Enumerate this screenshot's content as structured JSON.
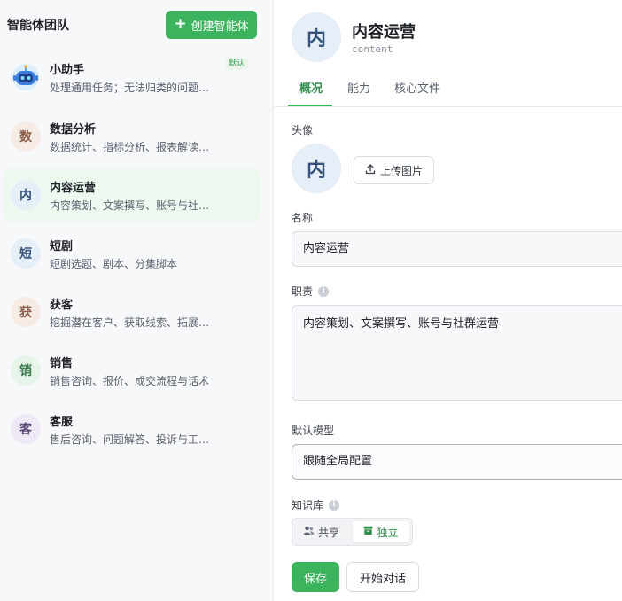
{
  "sidebar": {
    "title": "智能体团队",
    "create_label": "创建智能体",
    "default_badge": "默认",
    "agents": [
      {
        "avatar": "",
        "name": "小助手",
        "desc": "处理通用任务；无法归类的问题…",
        "is_default": true
      },
      {
        "avatar": "数",
        "name": "数据分析",
        "desc": "数据统计、指标分析、报表解读…",
        "avatar_bg": "#f7ebe6",
        "avatar_color": "#8a5a47"
      },
      {
        "avatar": "内",
        "name": "内容运营",
        "desc": "内容策划、文案撰写、账号与社…",
        "avatar_bg": "#e6eef8",
        "avatar_color": "#35537c",
        "active": true
      },
      {
        "avatar": "短",
        "name": "短剧",
        "desc": "短剧选题、剧本、分集脚本",
        "avatar_bg": "#e6eef8",
        "avatar_color": "#35537c"
      },
      {
        "avatar": "获",
        "name": "获客",
        "desc": "挖掘潜在客户、获取线索、拓展…",
        "avatar_bg": "#f7ebe6",
        "avatar_color": "#8a5a47"
      },
      {
        "avatar": "销",
        "name": "销售",
        "desc": "销售咨询、报价、成交流程与话术",
        "avatar_bg": "#e7f4ea",
        "avatar_color": "#3a7a4c"
      },
      {
        "avatar": "客",
        "name": "客服",
        "desc": "售后咨询、问题解答、投诉与工…",
        "avatar_bg": "#efe9f6",
        "avatar_color": "#5b4a78"
      }
    ]
  },
  "main": {
    "avatar": "内",
    "title": "内容运营",
    "subtitle": "content",
    "tabs": [
      {
        "label": "概况",
        "active": true
      },
      {
        "label": "能力"
      },
      {
        "label": "核心文件"
      }
    ],
    "form": {
      "avatar_label": "头像",
      "avatar_char": "内",
      "upload_label": "上传图片",
      "name_label": "名称",
      "name_value": "内容运营",
      "duty_label": "职责",
      "duty_value": "内容策划、文案撰写、账号与社群运营",
      "model_label": "默认模型",
      "model_value": "跟随全局配置",
      "kb_label": "知识库",
      "kb_options": [
        "共享",
        "独立"
      ],
      "kb_selected": "独立"
    },
    "actions": {
      "save": "保存",
      "start_chat": "开始对话"
    }
  },
  "colors": {
    "accent": "#3cb35d",
    "accent_text": "#2f8f4a",
    "active_item_bg": "#edf8ef"
  }
}
